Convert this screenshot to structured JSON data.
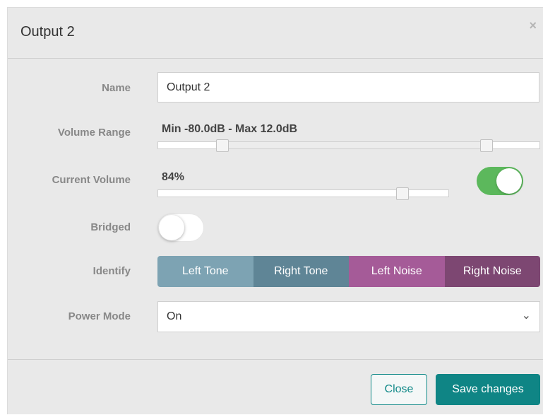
{
  "dialog": {
    "title": "Output 2",
    "close_icon": "close-icon"
  },
  "fields": {
    "name_label": "Name",
    "name_value": "Output 2",
    "volume_range_label": "Volume Range",
    "volume_range_text": "Min -80.0dB - Max 12.0dB",
    "volume_range_min_fraction": 0.17,
    "volume_range_max_fraction": 0.86,
    "current_volume_label": "Current Volume",
    "current_volume_text": "84%",
    "current_volume_value": 84,
    "current_volume_enabled": true,
    "bridged_label": "Bridged",
    "bridged_enabled": false,
    "identify_label": "Identify",
    "power_mode_label": "Power Mode",
    "power_mode_value": "On"
  },
  "identify_buttons": [
    {
      "label": "Left Tone",
      "color": "#7da3b3"
    },
    {
      "label": "Right Tone",
      "color": "#5f8596"
    },
    {
      "label": "Left Noise",
      "color": "#a55b98"
    },
    {
      "label": "Right Noise",
      "color": "#7d4772"
    }
  ],
  "footer": {
    "close_label": "Close",
    "save_label": "Save changes"
  },
  "colors": {
    "accent": "#0f8585",
    "toggle_on": "#5cb85c"
  }
}
